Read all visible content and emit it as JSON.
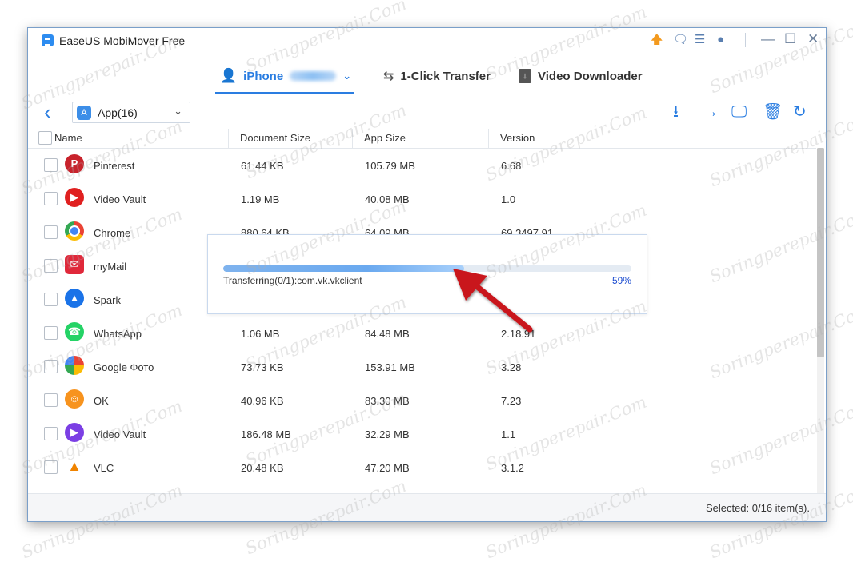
{
  "window": {
    "title": "EaseUS MobiMover Free",
    "title_icons": [
      "upgrade-arrow-icon",
      "feedback-icon",
      "menu-icon",
      "language-icon"
    ],
    "window_controls": [
      "minimize",
      "maximize",
      "close"
    ]
  },
  "nav": {
    "tabs": [
      {
        "label": "iPhone",
        "icon": "phone-user-icon",
        "active": true
      },
      {
        "label": "1-Click Transfer",
        "icon": "transfer-arrows-icon",
        "active": false
      },
      {
        "label": "Video Downloader",
        "icon": "video-download-icon",
        "active": false
      }
    ]
  },
  "toolbar": {
    "category_select": "App(16)",
    "actions": [
      "export-to-computer-icon",
      "transfer-to-device-icon",
      "to-computer-icon",
      "delete-icon",
      "refresh-icon"
    ]
  },
  "table": {
    "columns": [
      "Name",
      "Document Size",
      "App Size",
      "Version"
    ],
    "rows": [
      {
        "name": "Pinterest",
        "doc_size": "61.44 KB",
        "app_size": "105.79 MB",
        "version": "6.68",
        "color": "#c8232c"
      },
      {
        "name": "Video Vault",
        "doc_size": "1.19 MB",
        "app_size": "40.08 MB",
        "version": "1.0",
        "color": "#e02020"
      },
      {
        "name": "Chrome",
        "doc_size": "880.64 KB",
        "app_size": "64.09 MB",
        "version": "69.3497.91",
        "color": "#34a853"
      },
      {
        "name": "myMail",
        "doc_size": "",
        "app_size": "",
        "version": "",
        "color": "#e0283a"
      },
      {
        "name": "Spark",
        "doc_size": "",
        "app_size": "",
        "version": "",
        "color": "#1a73e8"
      },
      {
        "name": "WhatsApp",
        "doc_size": "1.06 MB",
        "app_size": "84.48 MB",
        "version": "2.18.91",
        "color": "#25d366"
      },
      {
        "name": "Google Фото",
        "doc_size": "73.73 KB",
        "app_size": "153.91 MB",
        "version": "3.28",
        "color": "#fbbc05"
      },
      {
        "name": "OK",
        "doc_size": "40.96 KB",
        "app_size": "83.30 MB",
        "version": "7.23",
        "color": "#f7931e"
      },
      {
        "name": "Video Vault",
        "doc_size": "186.48 MB",
        "app_size": "32.29 MB",
        "version": "1.1",
        "color": "#7b3fe4"
      },
      {
        "name": "VLC",
        "doc_size": "20.48 KB",
        "app_size": "47.20 MB",
        "version": "3.1.2",
        "color": "#f08300"
      }
    ]
  },
  "progress": {
    "text": "Transferring(0/1):com.vk.vkclient",
    "percent_label": "59%",
    "fraction": 0.59
  },
  "status": {
    "selected": "Selected: 0/16 item(s)."
  },
  "watermark": "Soringperepair.Com"
}
